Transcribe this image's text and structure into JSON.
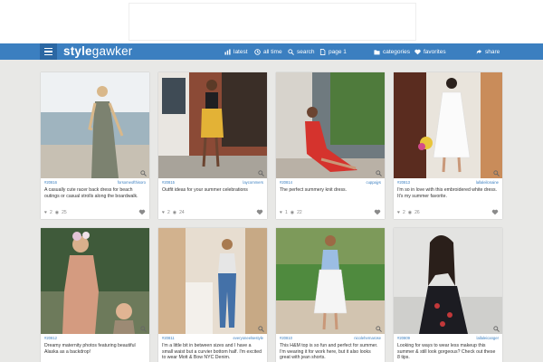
{
  "site": {
    "logo_bold": "style",
    "logo_rest": "gawker"
  },
  "nav": {
    "latest": "latest",
    "all_time": "all time",
    "search": "search",
    "page": "page 1",
    "categories": "categories",
    "favorites": "favorites",
    "share": "share"
  },
  "colors": {
    "navbar": "#3b7fc0",
    "menu": "#2b67a3",
    "link": "#3b7fc0"
  },
  "cards": [
    {
      "id": "#20816",
      "user": "forsomeofthisoro",
      "caption": "A casually cute racer back dress for beach outings or casual strolls along the boardwalk.",
      "hearts": "2",
      "views": "25"
    },
    {
      "id": "#20815",
      "user": "laycommers",
      "caption": "Outfit ideas for your summer celebrations",
      "hearts": "2",
      "views": "24"
    },
    {
      "id": "#20814",
      "user": "cuppajys",
      "caption": "The perfect summery knit dress.",
      "hearts": "1",
      "views": "22"
    },
    {
      "id": "#20813",
      "user": "lallaleilonaine",
      "caption": "I'm so in love with this embroidered white dress. It's my summer favorite.",
      "hearts": "2",
      "views": "26"
    },
    {
      "id": "#20812",
      "user": "",
      "caption": "Dreamy maternity photos featuring beautiful Alaska as a backdrop!",
      "hearts": "",
      "views": ""
    },
    {
      "id": "#20811",
      "user": "everyoneelsestyle",
      "caption": "I'm a little bit in between sizes and I have a small waist but a curvier bottom half. I'm excited to wear Mott & Bow NYC Denim.",
      "hearts": "",
      "views": ""
    },
    {
      "id": "#20810",
      "user": "nicolehernarose",
      "caption": "This H&M top is so fun and perfect for summer. I'm wearing it for work here, but it also looks great with jean shorts.",
      "hearts": "",
      "views": ""
    },
    {
      "id": "#20809",
      "user": "lallaleicanger",
      "caption": "Looking for ways to wear less makeup this summer & still look gorgeous? Check out these 8 tips.",
      "hearts": "",
      "views": ""
    }
  ]
}
